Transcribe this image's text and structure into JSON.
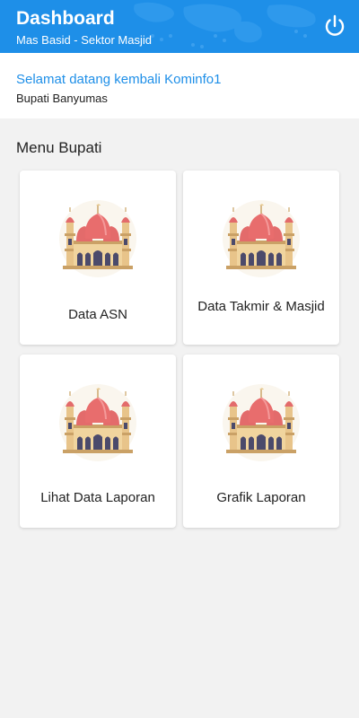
{
  "header": {
    "title": "Dashboard",
    "subtitle": "Mas Basid - Sektor Masjid",
    "power_icon": "power-icon",
    "color": "#1e8fe8"
  },
  "welcome": {
    "greeting": "Selamat datang kembali Kominfo1",
    "role": "Bupati Banyumas"
  },
  "menu": {
    "title": "Menu Bupati",
    "items": [
      {
        "label": "Data ASN",
        "icon": "mosque-icon"
      },
      {
        "label": "Data Takmir & Masjid",
        "icon": "mosque-icon"
      },
      {
        "label": "Lihat Data Laporan",
        "icon": "mosque-icon"
      },
      {
        "label": "Grafik Laporan",
        "icon": "mosque-icon"
      }
    ]
  }
}
